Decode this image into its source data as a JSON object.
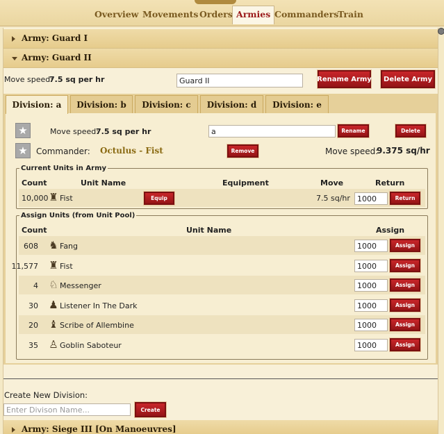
{
  "nav": {
    "tabs": [
      {
        "label": "Overview"
      },
      {
        "label": "Movements"
      },
      {
        "label": "Orders"
      },
      {
        "label": "Armies",
        "active": true
      },
      {
        "label": "Commanders"
      },
      {
        "label": "Train"
      }
    ]
  },
  "armies": {
    "first": {
      "title": "Army: Guard I",
      "expanded": false
    },
    "current": {
      "title": "Army: Guard II",
      "expanded": true,
      "move_speed_label": "Move speed:",
      "move_speed_value": "7.5 sq per hr",
      "name_value": "Guard II",
      "rename_label": "Rename Army",
      "delete_label": "Delete Army"
    },
    "last": {
      "title": "Army: Siege III [On Manoeuvres]",
      "expanded": false
    }
  },
  "divisions": {
    "tabs": [
      {
        "label": "Division: a",
        "active": true
      },
      {
        "label": "Division: b"
      },
      {
        "label": "Division: c"
      },
      {
        "label": "Division: d"
      },
      {
        "label": "Division: e"
      }
    ],
    "active": {
      "move_speed_label": "Move speed:",
      "move_speed_value": "7.5 sq per hr",
      "name_value": "a",
      "rename_label": "Rename",
      "delete_label": "Delete",
      "commander_label": "Commander:",
      "commander_name": "Octulus - Fist",
      "remove_label": "Remove",
      "commander_speed_label": "Move speed:",
      "commander_speed_value": "9.375 sq/hr",
      "star_icon": "star-icon"
    }
  },
  "current_units": {
    "legend": "Current Units in Army",
    "headers": {
      "count": "Count",
      "name": "Unit Name",
      "equipment": "Equipment",
      "move": "Move",
      "return": "Return"
    },
    "rows": [
      {
        "count": "10,000",
        "name": "Fist",
        "icon": "fist-unit-icon",
        "equip_label": "Equip",
        "move": "7.5 sq/hr",
        "qty": "1000",
        "return_label": "Return"
      }
    ]
  },
  "assign_units": {
    "legend": "Assign Units (from Unit Pool)",
    "headers": {
      "count": "Count",
      "name": "Unit Name",
      "assign": "Assign"
    },
    "rows": [
      {
        "count": "608",
        "name": "Fang",
        "icon": "fang-unit-icon",
        "glyph": "♞",
        "qty": "1000",
        "assign_label": "Assign"
      },
      {
        "count": "11,577",
        "name": "Fist",
        "icon": "fist-unit-icon",
        "glyph": "♜",
        "qty": "1000",
        "assign_label": "Assign"
      },
      {
        "count": "4",
        "name": "Messenger",
        "icon": "messenger-unit-icon",
        "glyph": "♘",
        "qty": "1000",
        "assign_label": "Assign"
      },
      {
        "count": "30",
        "name": "Listener In The Dark",
        "icon": "listener-unit-icon",
        "glyph": "♟",
        "qty": "1000",
        "assign_label": "Assign"
      },
      {
        "count": "20",
        "name": "Scribe of Allembine",
        "icon": "scribe-unit-icon",
        "glyph": "♝",
        "qty": "1000",
        "assign_label": "Assign"
      },
      {
        "count": "35",
        "name": "Goblin Saboteur",
        "icon": "goblin-unit-icon",
        "glyph": "♙",
        "qty": "1000",
        "assign_label": "Assign"
      }
    ]
  },
  "create_division": {
    "label": "Create New Division:",
    "placeholder": "Enter Divison Name...",
    "button_label": "Create"
  }
}
